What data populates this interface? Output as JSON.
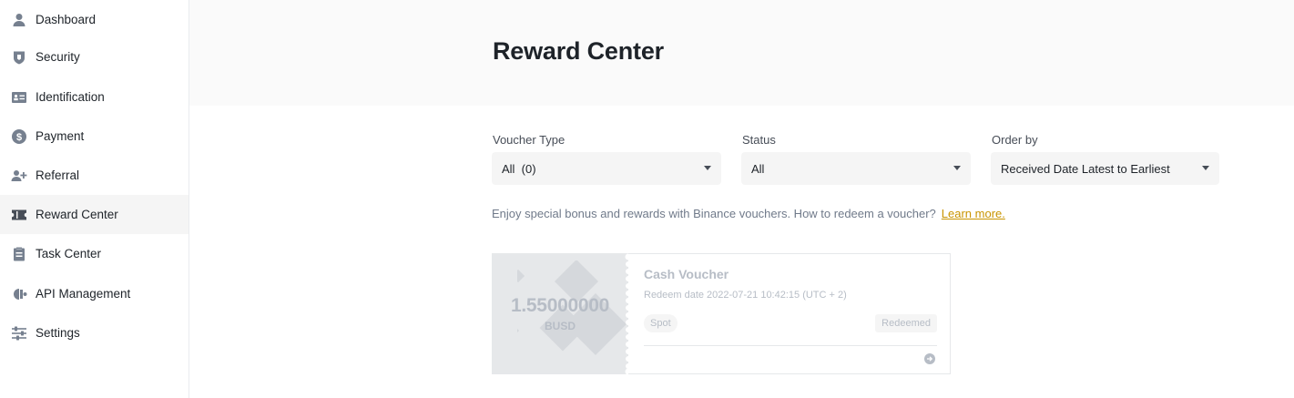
{
  "sidebar": {
    "items": [
      {
        "label": "Dashboard",
        "icon": "user-icon",
        "active": false
      },
      {
        "label": "Security",
        "icon": "shield-icon",
        "active": false
      },
      {
        "label": "Identification",
        "icon": "id-card-icon",
        "active": false
      },
      {
        "label": "Payment",
        "icon": "dollar-icon",
        "active": false
      },
      {
        "label": "Referral",
        "icon": "user-plus-icon",
        "active": false
      },
      {
        "label": "Reward Center",
        "icon": "ticket-icon",
        "active": true
      },
      {
        "label": "Task Center",
        "icon": "clipboard-icon",
        "active": false
      },
      {
        "label": "API Management",
        "icon": "api-icon",
        "active": false
      },
      {
        "label": "Settings",
        "icon": "sliders-icon",
        "active": false
      }
    ]
  },
  "page": {
    "title": "Reward Center"
  },
  "filters": {
    "voucher_type": {
      "label": "Voucher Type",
      "value": "All  (0)"
    },
    "status": {
      "label": "Status",
      "value": "All"
    },
    "order_by": {
      "label": "Order by",
      "value": "Received Date Latest to Earliest"
    }
  },
  "info": {
    "text": "Enjoy special bonus and rewards with Binance vouchers. How to redeem a voucher?",
    "link": "Learn more."
  },
  "voucher": {
    "amount": "1.55000000",
    "unit": "BUSD",
    "title": "Cash Voucher",
    "redeem_label": "Redeem date",
    "redeem_date": "2022-07-21 10:42:15 (UTC + 2)",
    "wallet_tag": "Spot",
    "status": "Redeemed"
  },
  "colors": {
    "accent_link": "#c99400",
    "muted_voucher": "#b7bdc6",
    "active_bg": "#f5f5f5"
  }
}
